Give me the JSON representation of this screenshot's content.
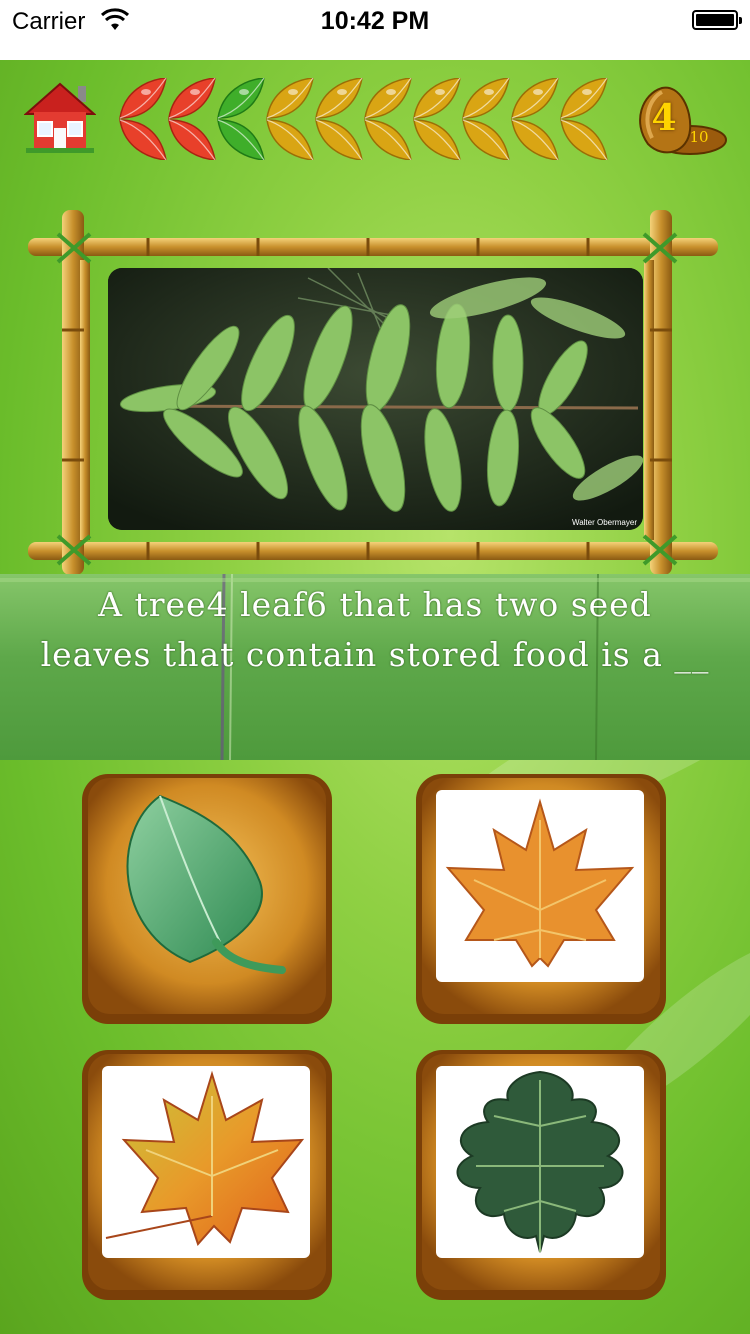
{
  "status_bar": {
    "carrier": "Carrier",
    "time": "10:42 PM"
  },
  "progress": {
    "leaves": [
      "red",
      "red",
      "green",
      "yellow",
      "yellow",
      "yellow",
      "yellow",
      "yellow",
      "yellow",
      "yellow"
    ]
  },
  "score": {
    "current": "4",
    "total": "10"
  },
  "photo": {
    "credit": "Walter Obermayer"
  },
  "question": {
    "text": "A tree4 leaf6 that has two seed leaves that contain stored food is a __"
  },
  "answers": [
    {
      "name": "answer-green-leaf"
    },
    {
      "name": "answer-orange-maple-leaf"
    },
    {
      "name": "answer-autumn-maple-leaf"
    },
    {
      "name": "answer-oak-leaf"
    }
  ],
  "colors": {
    "red": "#e8402a",
    "green": "#3fae2a",
    "yellow": "#d9a514",
    "background": "#8fd043"
  }
}
